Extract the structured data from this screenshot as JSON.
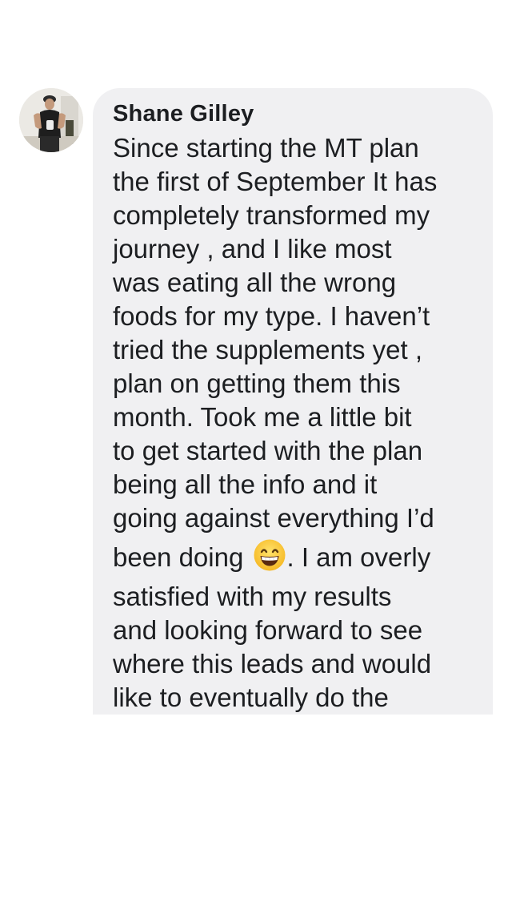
{
  "comment": {
    "author": "Shane Gilley",
    "avatar_icon": "profile-photo",
    "emoji_icon": "grinning-face-with-smiling-eyes",
    "lines": [
      "Since starting the MT plan",
      "the first of September It has",
      "completely transformed my",
      "journey , and I like most",
      "was eating all the wrong",
      "foods for my type. I haven’t",
      "tried the supplements yet ,",
      "plan on getting them this",
      "month. Took me a little bit",
      "to get started with the plan",
      "being all the info and it",
      "going against everything I’d"
    ],
    "emoji_line_before": "been doing",
    "emoji_line_after": ". I am overly",
    "lines_after": [
      "satisfied with my results",
      "and looking forward to see",
      "where this leads and would",
      "like to eventually do the"
    ]
  },
  "colors": {
    "bubble_background": "#f0f0f2",
    "text": "#1c1e21",
    "page_background": "#ffffff"
  }
}
